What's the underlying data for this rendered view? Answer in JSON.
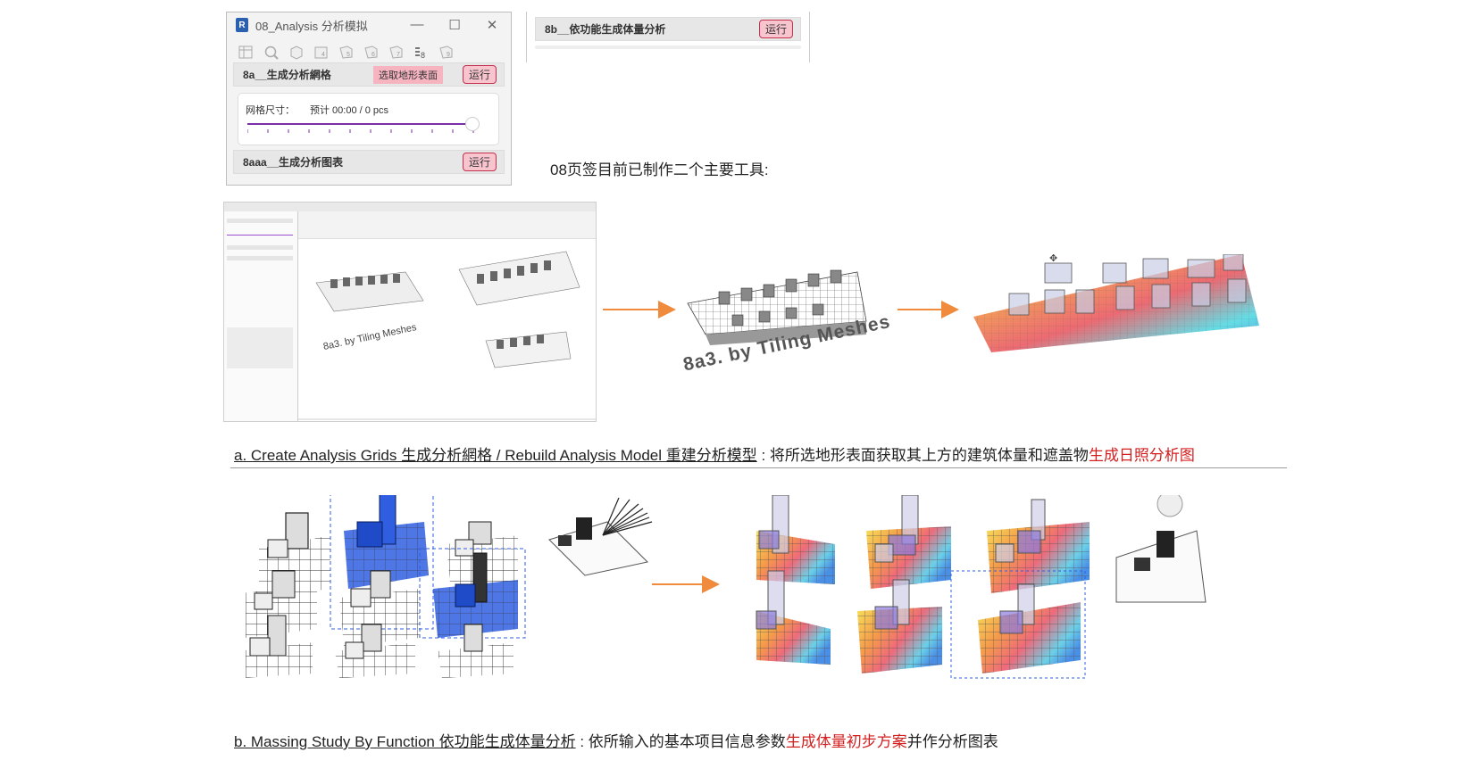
{
  "plugin_window": {
    "title": "08_Analysis 分析模拟",
    "app_icon": "R",
    "controls": {
      "minimize": "—",
      "maximize": "☐",
      "close": "✕"
    },
    "tab_icons": [
      "table-icon",
      "search-chart-icon",
      "cube-icon",
      "chart4-icon",
      "cube5-icon",
      "cube6-icon",
      "cube7-icon",
      "bars-8-icon",
      "cube9-icon"
    ],
    "active_tab": 7,
    "row_8a": {
      "label": "8a__生成分析網格",
      "pick_label": "选取地形表面",
      "run_label": "运行"
    },
    "grid_size_label": "网格尺寸：",
    "estimate_label": "预计 00:00 / 0 pcs",
    "row_8aaa": {
      "label": "8aaa__生成分析图表",
      "run_label": "运行"
    }
  },
  "window_8b": {
    "label": "8b__依功能生成体量分析",
    "run_label": "运行"
  },
  "intro_text": "08页签目前已制作二个主要工具:",
  "revit_preview": {
    "panel_rows": [
      "8a__生成分析網格",
      "8aaa__生成分析图表",
      "8b__依功能生成体量分析"
    ],
    "watermark": "8a3. by Tiling Meshes"
  },
  "section_a": {
    "watermark": "8a3. by Tiling Meshes",
    "caption_link": "a. Create Analysis Grids 生成分析網格 / Rebuild Analysis Model 重建分析模型",
    "caption_text": " : 将所选地形表面获取其上方的建筑体量和遮盖物",
    "caption_highlight": "生成日照分析图"
  },
  "section_b": {
    "caption_link": "b. Massing Study By Function 依功能生成体量分析",
    "caption_text": " : 依所输入的基本项目信息参数",
    "caption_highlight": "生成体量初步方案",
    "caption_tail": "并作分析图表"
  },
  "colors": {
    "run_bg": "#f8c5cf",
    "run_border": "#c3314d",
    "accent_purple": "#7a2fa8",
    "arrow": "#f08a3c",
    "highlight_red": "#d41f1f",
    "mass_blue": "#2f5fe0"
  }
}
